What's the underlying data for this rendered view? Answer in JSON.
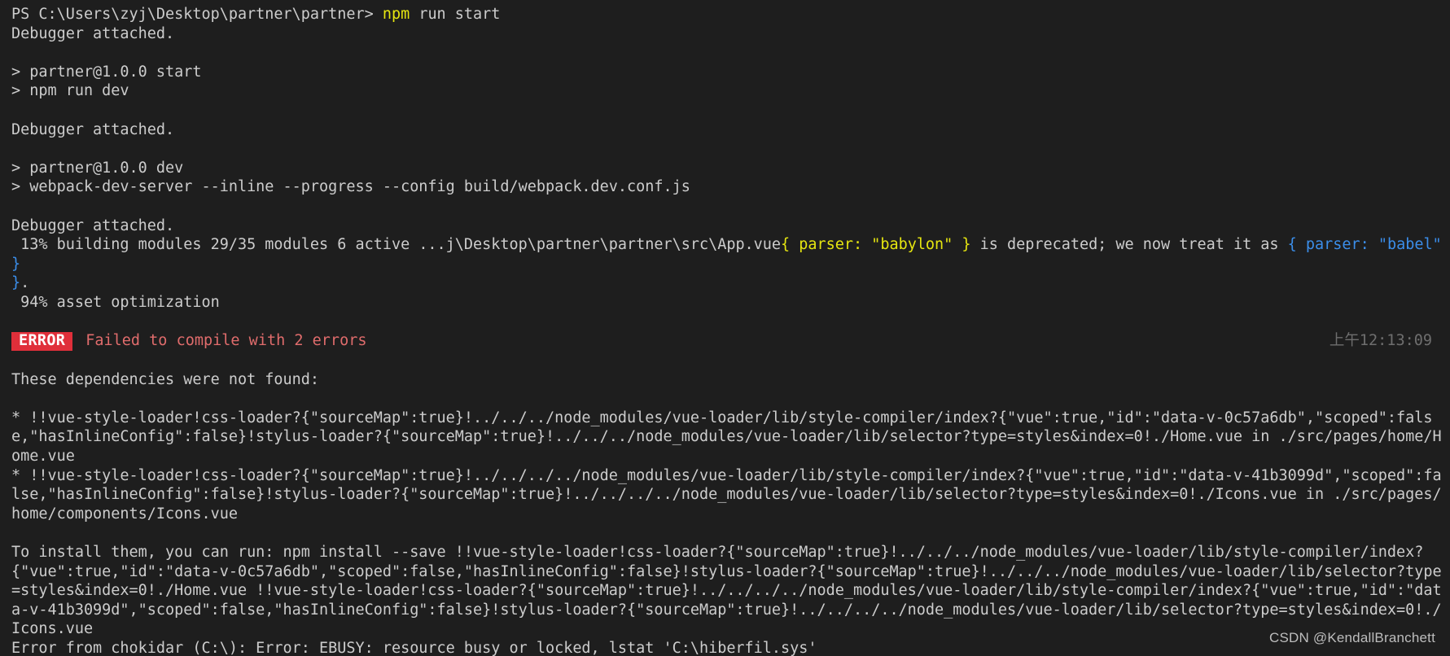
{
  "terminal": {
    "prompt": {
      "path": "PS C:\\Users\\zyj\\Desktop\\partner\\partner> ",
      "command": "npm",
      "args": " run start"
    },
    "lines": {
      "debugger_1": "Debugger attached.",
      "blank_1": " ",
      "script_start": "> partner@1.0.0 start",
      "script_start_cmd": "> npm run dev",
      "blank_2": " ",
      "debugger_2": "Debugger attached.",
      "blank_3": " ",
      "script_dev": "> partner@1.0.0 dev",
      "script_dev_cmd": "> webpack-dev-server --inline --progress --config build/webpack.dev.conf.js",
      "blank_4": " ",
      "debugger_3": "Debugger attached.",
      "progress_build_prefix": " 13% building modules 29/35 modules 6 active ...j\\Desktop\\partner\\partner\\src\\App.vue",
      "deprecation_babylon": "{ parser: \"babylon\" }",
      "deprecation_mid": " is deprecated; we now treat it as ",
      "deprecation_babel": "{ parser: \"babel\" }",
      "deprecation_tail_brace": "}",
      "deprecation_tail_dot": ".",
      "progress_asset": " 94% asset optimization",
      "blank_5": " ",
      "error_badge": "ERROR",
      "error_message": "Failed to compile with 2 errors",
      "error_time": "上午12:13:09",
      "blank_6": " ",
      "deps_header": "These dependencies were not found:",
      "blank_7": " ",
      "dep_1": "* !!vue-style-loader!css-loader?{\"sourceMap\":true}!../../../node_modules/vue-loader/lib/style-compiler/index?{\"vue\":true,\"id\":\"data-v-0c57a6db\",\"scoped\":false,\"hasInlineConfig\":false}!stylus-loader?{\"sourceMap\":true}!../../../node_modules/vue-loader/lib/selector?type=styles&index=0!./Home.vue in ./src/pages/home/Home.vue",
      "dep_2": "* !!vue-style-loader!css-loader?{\"sourceMap\":true}!../../../../node_modules/vue-loader/lib/style-compiler/index?{\"vue\":true,\"id\":\"data-v-41b3099d\",\"scoped\":false,\"hasInlineConfig\":false}!stylus-loader?{\"sourceMap\":true}!../../../../node_modules/vue-loader/lib/selector?type=styles&index=0!./Icons.vue in ./src/pages/home/components/Icons.vue",
      "blank_8": " ",
      "install_hint": "To install them, you can run: npm install --save !!vue-style-loader!css-loader?{\"sourceMap\":true}!../../../node_modules/vue-loader/lib/style-compiler/index?{\"vue\":true,\"id\":\"data-v-0c57a6db\",\"scoped\":false,\"hasInlineConfig\":false}!stylus-loader?{\"sourceMap\":true}!../../../node_modules/vue-loader/lib/selector?type=styles&index=0!./Home.vue !!vue-style-loader!css-loader?{\"sourceMap\":true}!../../../../node_modules/vue-loader/lib/style-compiler/index?{\"vue\":true,\"id\":\"data-v-41b3099d\",\"scoped\":false,\"hasInlineConfig\":false}!stylus-loader?{\"sourceMap\":true}!../../../../node_modules/vue-loader/lib/selector?type=styles&index=0!./Icons.vue",
      "chokidar_error": "Error from chokidar (C:\\): Error: EBUSY: resource busy or locked, lstat 'C:\\hiberfil.sys'"
    },
    "colors": {
      "background": "#1e1e1e",
      "foreground": "#cccccc",
      "yellow": "#e5e510",
      "blue": "#3b8eea",
      "error_badge_bg": "#e02f3a",
      "error_text": "#e06c6c",
      "dim": "#6e6e6e"
    }
  },
  "watermark": {
    "text": "CSDN @KendallBranchett"
  }
}
